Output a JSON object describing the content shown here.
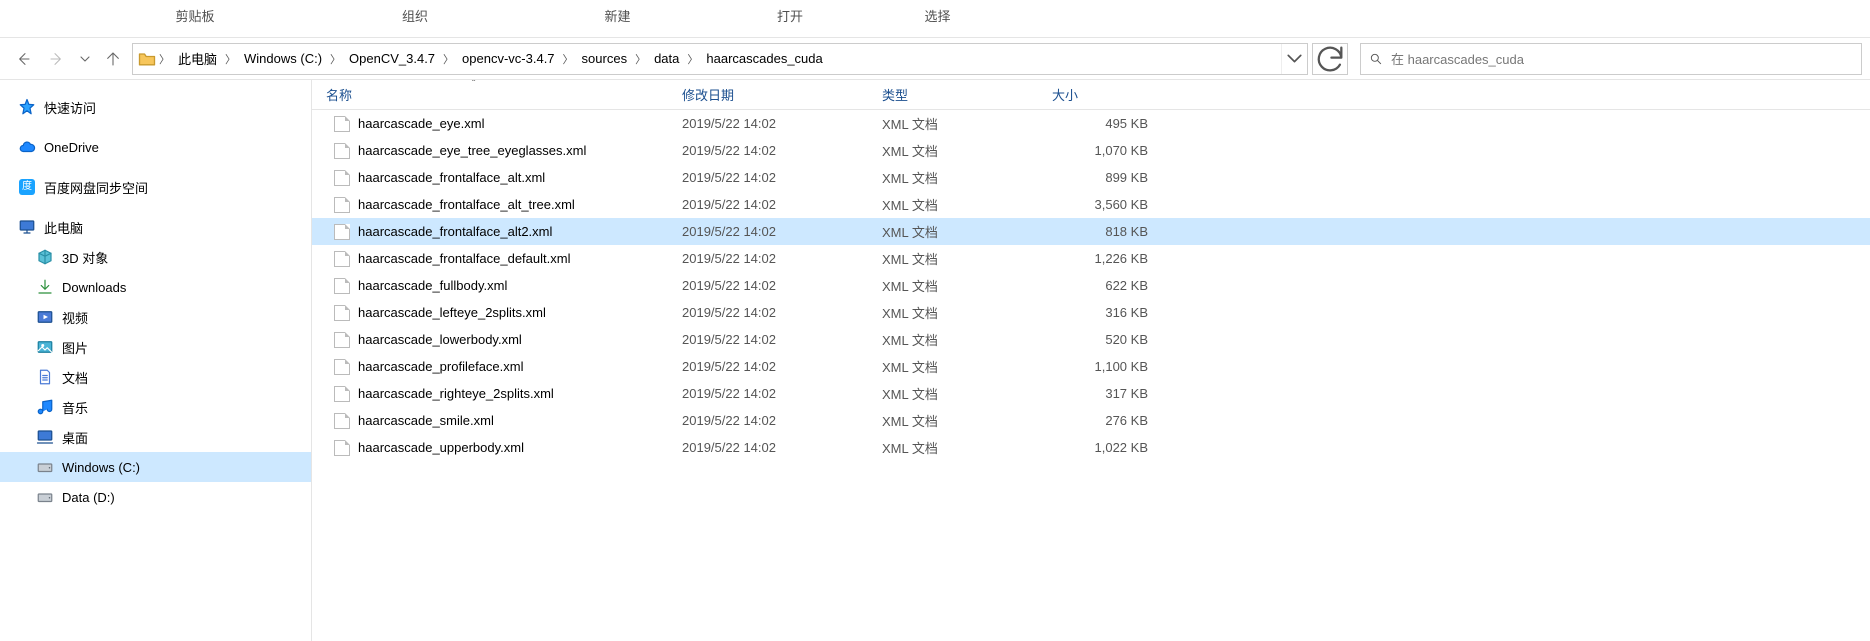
{
  "ribbon": {
    "clipboard": "剪贴板",
    "organize": "组织",
    "new": "新建",
    "open": "打开",
    "select": "选择"
  },
  "nav": {
    "back_enabled": true,
    "forward_enabled": false
  },
  "breadcrumb": [
    "此电脑",
    "Windows (C:)",
    "OpenCV_3.4.7",
    "opencv-vc-3.4.7",
    "sources",
    "data",
    "haarcascades_cuda"
  ],
  "search": {
    "placeholder": "在 haarcascades_cuda"
  },
  "tree": {
    "quick_access": "快速访问",
    "onedrive": "OneDrive",
    "baidu": "百度网盘同步空间",
    "this_pc": "此电脑",
    "children": [
      {
        "label": "3D 对象",
        "icon": "3d"
      },
      {
        "label": "Downloads",
        "icon": "downloads"
      },
      {
        "label": "视频",
        "icon": "video"
      },
      {
        "label": "图片",
        "icon": "pictures"
      },
      {
        "label": "文档",
        "icon": "docs"
      },
      {
        "label": "音乐",
        "icon": "music"
      },
      {
        "label": "桌面",
        "icon": "desktop"
      },
      {
        "label": "Windows (C:)",
        "icon": "drive",
        "selected": true
      },
      {
        "label": "Data (D:)",
        "icon": "drive"
      }
    ]
  },
  "columns": {
    "name": "名称",
    "modified": "修改日期",
    "type": "类型",
    "size": "大小"
  },
  "files": [
    {
      "name": "haarcascade_eye.xml",
      "modified": "2019/5/22 14:02",
      "type": "XML 文档",
      "size": "495 KB"
    },
    {
      "name": "haarcascade_eye_tree_eyeglasses.xml",
      "modified": "2019/5/22 14:02",
      "type": "XML 文档",
      "size": "1,070 KB"
    },
    {
      "name": "haarcascade_frontalface_alt.xml",
      "modified": "2019/5/22 14:02",
      "type": "XML 文档",
      "size": "899 KB"
    },
    {
      "name": "haarcascade_frontalface_alt_tree.xml",
      "modified": "2019/5/22 14:02",
      "type": "XML 文档",
      "size": "3,560 KB"
    },
    {
      "name": "haarcascade_frontalface_alt2.xml",
      "modified": "2019/5/22 14:02",
      "type": "XML 文档",
      "size": "818 KB",
      "selected": true
    },
    {
      "name": "haarcascade_frontalface_default.xml",
      "modified": "2019/5/22 14:02",
      "type": "XML 文档",
      "size": "1,226 KB"
    },
    {
      "name": "haarcascade_fullbody.xml",
      "modified": "2019/5/22 14:02",
      "type": "XML 文档",
      "size": "622 KB"
    },
    {
      "name": "haarcascade_lefteye_2splits.xml",
      "modified": "2019/5/22 14:02",
      "type": "XML 文档",
      "size": "316 KB"
    },
    {
      "name": "haarcascade_lowerbody.xml",
      "modified": "2019/5/22 14:02",
      "type": "XML 文档",
      "size": "520 KB"
    },
    {
      "name": "haarcascade_profileface.xml",
      "modified": "2019/5/22 14:02",
      "type": "XML 文档",
      "size": "1,100 KB"
    },
    {
      "name": "haarcascade_righteye_2splits.xml",
      "modified": "2019/5/22 14:02",
      "type": "XML 文档",
      "size": "317 KB"
    },
    {
      "name": "haarcascade_smile.xml",
      "modified": "2019/5/22 14:02",
      "type": "XML 文档",
      "size": "276 KB"
    },
    {
      "name": "haarcascade_upperbody.xml",
      "modified": "2019/5/22 14:02",
      "type": "XML 文档",
      "size": "1,022 KB"
    }
  ]
}
